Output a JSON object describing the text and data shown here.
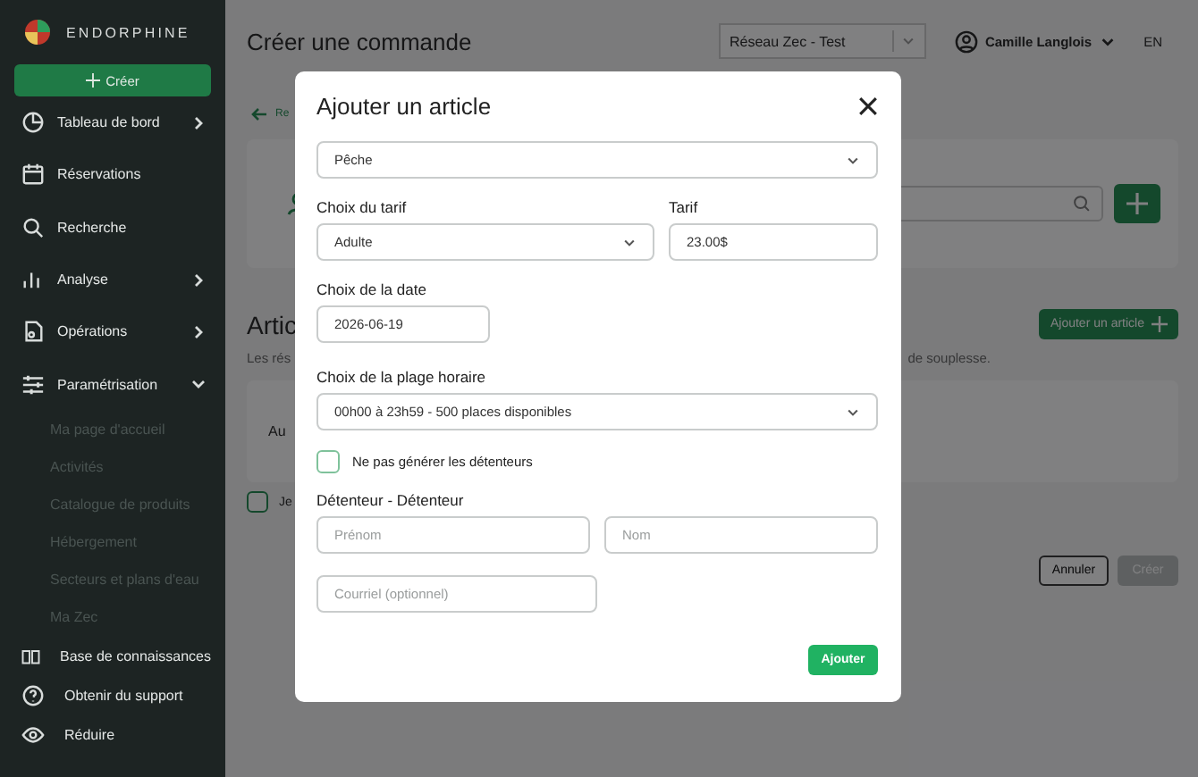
{
  "sidebar": {
    "logo": "ENDORPHINE",
    "create_button": "Créer",
    "items": [
      {
        "label": "Tableau de bord",
        "kind": "expandable",
        "expanded": false
      },
      {
        "label": "Réservations",
        "kind": "plain"
      },
      {
        "label": "Recherche",
        "kind": "plain"
      },
      {
        "label": "Analyse",
        "kind": "expandable",
        "expanded": false
      },
      {
        "label": "Opérations",
        "kind": "expandable",
        "expanded": false
      },
      {
        "label": "Paramétrisation",
        "kind": "expandable",
        "expanded": true,
        "children": [
          "Ma page d'accueil",
          "Activités",
          "Catalogue de produits",
          "Hébergement",
          "Secteurs et plans d'eau",
          "Ma Zec"
        ]
      }
    ],
    "footer_items": [
      "Base de connaissances",
      "Obtenir du support",
      "Réduire"
    ]
  },
  "header": {
    "title": "Créer une commande",
    "network_select": "Réseau Zec - Test",
    "user": "Camille Langlois",
    "language": "EN"
  },
  "page": {
    "back_link": "Re",
    "section_title": "Artic",
    "add_article_button": "Ajouter un article",
    "description_start": "Les rés",
    "description_end": "de souplesse.",
    "table_cell": "Au",
    "consent_label": "Je",
    "consent_checked": false,
    "buttons": [
      "Annuler",
      "Créer"
    ]
  },
  "modal": {
    "title": "Ajouter un article",
    "activity_select": "Pêche",
    "tariff_label": "Choix du tarif",
    "tariff_select": "Adulte",
    "price_label": "Tarif",
    "price_value": "23.00$",
    "date_label": "Choix de la date",
    "date_value": "2026-06-19",
    "slot_label": "Choix de la plage horaire",
    "slot_select": "00h00 à 23h59 - 500 places disponibles",
    "no_holders": {
      "label": "Ne pas générer les détenteurs",
      "checked": false
    },
    "holder_label": "Détenteur - Détenteur",
    "first_name": {
      "placeholder": "Prénom"
    },
    "last_name": {
      "placeholder": "Nom"
    },
    "email": {
      "placeholder": "Courriel (optionnel)"
    },
    "submit_button": "Ajouter"
  }
}
